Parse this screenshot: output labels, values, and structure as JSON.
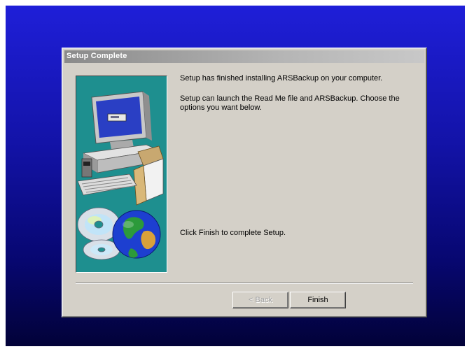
{
  "dialog": {
    "title": "Setup Complete",
    "line1": "Setup has finished installing ARSBackup on your computer.",
    "line2": "Setup can launch the Read Me file and ARSBackup.  Choose the options you want below.",
    "line3": "Click Finish to complete Setup."
  },
  "buttons": {
    "back_label": "< Back",
    "finish_label": "Finish",
    "back_enabled": false
  },
  "colors": {
    "desktop_top": "#1f1fd8",
    "desktop_bottom": "#020238",
    "dialog_bg": "#d4d0c8",
    "art_bg": "#1e8f8f"
  },
  "icons": [
    "computer-icon",
    "cd-icon",
    "globe-icon"
  ]
}
